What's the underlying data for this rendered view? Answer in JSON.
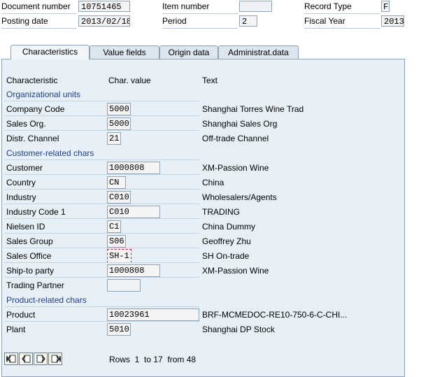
{
  "header": {
    "document_number": {
      "label": "Document number",
      "value": "10751465"
    },
    "posting_date": {
      "label": "Posting date",
      "value": "2013/02/18"
    },
    "item_number": {
      "label": "Item number",
      "value": ""
    },
    "period": {
      "label": "Period",
      "value": "2"
    },
    "record_type": {
      "label": "Record Type",
      "value": "F"
    },
    "fiscal_year": {
      "label": "Fiscal Year",
      "value": "2013"
    }
  },
  "tabs": [
    {
      "label": "Characteristics",
      "active": true
    },
    {
      "label": "Value fields",
      "active": false
    },
    {
      "label": "Origin data",
      "active": false
    },
    {
      "label": "Administrat.data",
      "active": false
    }
  ],
  "columns": {
    "characteristic": "Characteristic",
    "char_value": "Char. value",
    "text": "Text"
  },
  "sections": {
    "org": "Organizational units",
    "customer": "Customer-related chars",
    "product": "Product-related chars"
  },
  "rows": {
    "company_code": {
      "label": "Company Code",
      "value": "5000",
      "text": "Shanghai Torres Wine Trad"
    },
    "sales_org": {
      "label": "Sales Org.",
      "value": "5000",
      "text": "Shanghai Sales Org"
    },
    "distr_channel": {
      "label": "Distr. Channel",
      "value": "21",
      "text": "Off-trade Channel"
    },
    "customer": {
      "label": "Customer",
      "value": "1000808",
      "text": "XM-Passion Wine"
    },
    "country": {
      "label": "Country",
      "value": "CN",
      "text": "China"
    },
    "industry": {
      "label": "Industry",
      "value": "C010",
      "text": "Wholesalers/Agents"
    },
    "industry_code_1": {
      "label": "Industry Code 1",
      "value": "C010",
      "text": "TRADING"
    },
    "nielsen_id": {
      "label": "Nielsen ID",
      "value": "C1",
      "text": "China Dummy"
    },
    "sales_group": {
      "label": "Sales Group",
      "value": "S06",
      "text": "Geoffrey Zhu"
    },
    "sales_office": {
      "label": "Sales Office",
      "value": "SH-1",
      "text": "SH On-trade"
    },
    "ship_to_party": {
      "label": "Ship-to party",
      "value": "1000808",
      "text": "XM-Passion Wine"
    },
    "trading_partner": {
      "label": "Trading Partner",
      "value": "",
      "text": ""
    },
    "product": {
      "label": "Product",
      "value": "10023961",
      "text": "BRF-MCMEDOC-RE10-750-6-C-CHI..."
    },
    "plant": {
      "label": "Plant",
      "value": "5010",
      "text": "Shanghai DP Stock"
    }
  },
  "footer": {
    "rows_text": "Rows  1  to 17  from 48",
    "buttons": [
      "first-page-icon",
      "previous-page-icon",
      "next-page-icon",
      "last-page-icon"
    ]
  },
  "colors": {
    "panel": "#e6f0f6",
    "section_text": "#1f3f8f",
    "field_border": "#8fa3b8"
  }
}
